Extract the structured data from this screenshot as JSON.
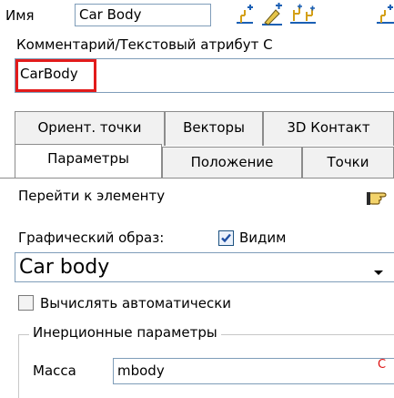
{
  "header": {
    "name_label": "Имя",
    "name_value": "Car Body",
    "tool_icons": [
      "add-point-icon",
      "edit-geometry-icon",
      "grid-points-icon",
      "add-point-icon-2"
    ]
  },
  "comment": {
    "label": "Комментарий/Текстовый атрибут С",
    "value": "CarBody",
    "highlight_color": "#e21b1b"
  },
  "tabs_row1": [
    "Ориент. точки",
    "Векторы",
    "3D Контакт"
  ],
  "tabs_row2": [
    "Параметры",
    "Положение",
    "Точки"
  ],
  "active_tab": "Параметры",
  "panel": {
    "goto_label": "Перейти к элементу",
    "image_label": "Графический образ:",
    "visible_label": "Видим",
    "visible_checked": true,
    "image_value": "Car body",
    "autocalc_label": "Вычислять автоматически",
    "autocalc_checked": false,
    "inertia_title": "Инерционные параметры",
    "mass_label": "Масса",
    "mass_value": "mbody",
    "mass_marker": "С"
  }
}
